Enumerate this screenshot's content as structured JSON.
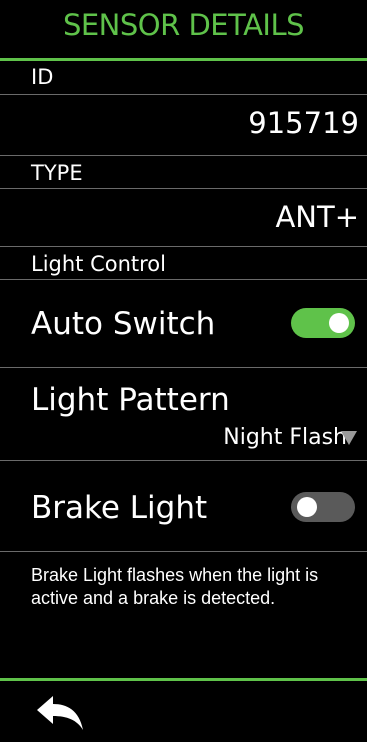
{
  "header": {
    "title": "SENSOR DETAILS"
  },
  "id_section": {
    "label": "ID",
    "value": "915719"
  },
  "type_section": {
    "label": "TYPE",
    "value": "ANT+"
  },
  "light_control": {
    "label": "Light Control"
  },
  "auto_switch": {
    "label": "Auto Switch",
    "state": "on"
  },
  "light_pattern": {
    "label": "Light Pattern",
    "selected": "Night Flash"
  },
  "brake_light": {
    "label": "Brake Light",
    "state": "off"
  },
  "help_text": "Brake Light flashes when the light is active and a brake is detected.",
  "footer": {
    "back_icon": "back-arrow-icon"
  },
  "colors": {
    "accent": "#5fc24a",
    "background": "#000000",
    "divider": "#6a6a6a"
  }
}
